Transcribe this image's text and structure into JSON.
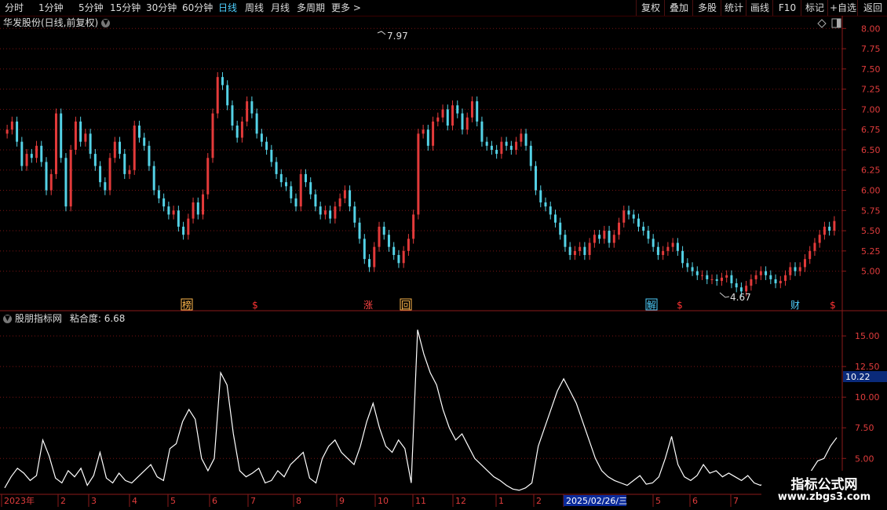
{
  "toolbar": {
    "periods": [
      "分时",
      "1分钟",
      "5分钟",
      "15分钟",
      "30分钟",
      "60分钟",
      "日线",
      "周线",
      "月线",
      "多周期",
      "更多 >"
    ],
    "active_period": "日线",
    "right_buttons": [
      "复权",
      "叠加",
      "多股",
      "统计",
      "画线",
      "F10",
      "标记",
      "+自选",
      "返回"
    ]
  },
  "main_chart": {
    "title": "华发股份(日线,前复权)",
    "high_label": "7.97",
    "low_label": "4.67",
    "markers": [
      {
        "text": "榜",
        "color": "#ffb84d",
        "boxed": true
      },
      {
        "text": "$",
        "color": "#ff3333",
        "boxed": false
      },
      {
        "text": "涨",
        "color": "#ff4444",
        "boxed": false
      },
      {
        "text": "回",
        "color": "#ffb84d",
        "boxed": true
      },
      {
        "text": "解",
        "color": "#4fd0ff",
        "boxed": true
      },
      {
        "text": "$",
        "color": "#ff3333",
        "boxed": false
      },
      {
        "text": "财",
        "color": "#4fd0ff",
        "boxed": false
      },
      {
        "text": "$",
        "color": "#ff3333",
        "boxed": false
      }
    ]
  },
  "indicator": {
    "name": "股朋指标网",
    "label": "粘合度",
    "value": "6.68",
    "current_tag": "10.22"
  },
  "date_axis": {
    "labels": [
      "2023年",
      "2",
      "3",
      "4",
      "5",
      "6",
      "7",
      "8",
      "9",
      "10",
      "11",
      "12",
      "1",
      "2",
      "2025/02/26/三",
      "5",
      "6",
      "7"
    ]
  },
  "watermark": {
    "line1": "指标公式网",
    "line2": "www.zbgs3.com"
  },
  "chart_data": [
    {
      "type": "candlestick",
      "title": "华发股份(日线,前复权)",
      "y_ticks": [
        5.0,
        5.25,
        5.5,
        5.75,
        6.0,
        6.25,
        6.5,
        6.75,
        7.0,
        7.25,
        7.5,
        7.75,
        8.0
      ],
      "ylim": [
        4.55,
        8.1
      ],
      "grid": true,
      "closes": [
        6.75,
        6.85,
        6.6,
        6.3,
        6.45,
        6.4,
        6.55,
        6.35,
        6.0,
        6.2,
        6.95,
        6.4,
        5.8,
        6.5,
        6.85,
        6.6,
        6.7,
        6.45,
        6.3,
        6.1,
        6.0,
        6.4,
        6.6,
        6.45,
        6.2,
        6.25,
        6.8,
        6.65,
        6.55,
        6.3,
        6.0,
        5.9,
        5.8,
        5.7,
        5.75,
        5.55,
        5.45,
        5.65,
        5.85,
        5.7,
        5.95,
        6.4,
        6.95,
        7.4,
        7.3,
        7.05,
        6.8,
        6.65,
        6.85,
        7.1,
        6.95,
        6.7,
        6.6,
        6.5,
        6.35,
        6.2,
        6.1,
        6.05,
        5.9,
        5.8,
        6.2,
        6.1,
        5.95,
        5.8,
        5.7,
        5.75,
        5.65,
        5.8,
        5.9,
        6.0,
        5.8,
        5.6,
        5.4,
        5.15,
        5.05,
        5.3,
        5.55,
        5.45,
        5.3,
        5.2,
        5.1,
        5.25,
        5.4,
        5.7,
        6.7,
        6.75,
        6.55,
        6.85,
        6.9,
        7.0,
        6.8,
        7.05,
        6.95,
        6.75,
        6.9,
        7.1,
        6.85,
        6.6,
        6.55,
        6.5,
        6.45,
        6.6,
        6.55,
        6.5,
        6.6,
        6.7,
        6.55,
        6.3,
        6.0,
        5.85,
        5.8,
        5.7,
        5.6,
        5.45,
        5.3,
        5.2,
        5.25,
        5.3,
        5.2,
        5.35,
        5.45,
        5.4,
        5.5,
        5.35,
        5.45,
        5.6,
        5.75,
        5.7,
        5.65,
        5.55,
        5.5,
        5.4,
        5.3,
        5.2,
        5.25,
        5.3,
        5.35,
        5.25,
        5.1,
        5.05,
        5.0,
        4.95,
        4.95,
        4.9,
        4.9,
        4.88,
        4.92,
        4.95,
        4.85,
        4.8,
        4.75,
        4.82,
        4.9,
        4.95,
        5.0,
        4.95,
        4.9,
        4.85,
        4.88,
        4.95,
        5.05,
        5.0,
        5.05,
        5.15,
        5.25,
        5.35,
        5.45,
        5.55,
        5.5,
        5.62
      ]
    },
    {
      "type": "line",
      "title": "粘合度",
      "y_ticks": [
        5.0,
        7.5,
        10.0,
        12.5,
        15.0
      ],
      "ylim": [
        2.2,
        16.8
      ],
      "grid": true,
      "values": [
        2.6,
        3.5,
        4.2,
        3.8,
        3.2,
        3.6,
        6.5,
        5.2,
        3.4,
        3.0,
        4.0,
        3.5,
        4.2,
        2.8,
        3.6,
        5.5,
        3.4,
        3.0,
        3.8,
        3.2,
        3.0,
        3.5,
        4.0,
        4.5,
        3.5,
        3.2,
        5.8,
        6.2,
        8.0,
        9.0,
        8.2,
        5.0,
        4.0,
        5.0,
        12.0,
        11.0,
        7.0,
        4.0,
        3.5,
        3.8,
        4.2,
        3.0,
        3.2,
        4.0,
        3.5,
        4.5,
        5.0,
        5.5,
        3.4,
        3.0,
        5.0,
        6.0,
        6.5,
        5.5,
        5.0,
        4.5,
        6.0,
        8.0,
        9.5,
        7.5,
        6.0,
        5.5,
        6.5,
        5.8,
        3.0,
        15.5,
        13.5,
        12.0,
        11.0,
        9.0,
        7.5,
        6.5,
        7.0,
        6.0,
        5.0,
        4.5,
        4.0,
        3.5,
        3.2,
        2.8,
        2.5,
        2.4,
        2.6,
        3.0,
        6.0,
        7.5,
        9.0,
        10.5,
        11.5,
        10.5,
        9.5,
        8.0,
        6.5,
        5.0,
        4.0,
        3.5,
        3.2,
        3.0,
        2.8,
        3.2,
        3.6,
        2.9,
        3.0,
        3.5,
        5.0,
        6.8,
        4.5,
        3.5,
        3.2,
        3.6,
        4.5,
        3.8,
        4.0,
        3.5,
        3.8,
        3.5,
        3.2,
        3.6,
        3.0,
        2.8,
        3.2,
        2.9,
        2.7,
        2.9,
        3.2,
        3.0,
        2.8,
        4.0,
        4.8,
        5.0,
        6.0,
        6.7
      ]
    }
  ]
}
